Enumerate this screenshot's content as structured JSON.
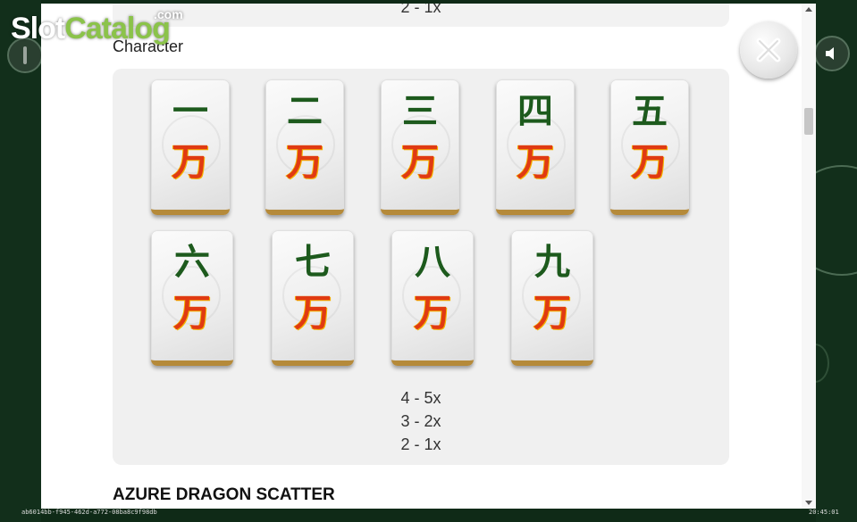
{
  "logo": {
    "part1": "Slot",
    "part2": "Catalog",
    "suffix": ".com"
  },
  "top_card": {
    "pay_line": "2 - 1x"
  },
  "character_section": {
    "title": "Character",
    "tiles": [
      {
        "numeral": "一",
        "suit": "万"
      },
      {
        "numeral": "二",
        "suit": "万"
      },
      {
        "numeral": "三",
        "suit": "万"
      },
      {
        "numeral": "四",
        "suit": "万"
      },
      {
        "numeral": "五",
        "suit": "万"
      },
      {
        "numeral": "六",
        "suit": "万"
      },
      {
        "numeral": "七",
        "suit": "万"
      },
      {
        "numeral": "八",
        "suit": "万"
      },
      {
        "numeral": "九",
        "suit": "万"
      }
    ],
    "pays": [
      "4 - 5x",
      "3 - 2x",
      "2 - 1x"
    ]
  },
  "next_section": {
    "title": "AZURE DRAGON SCATTER"
  },
  "footer": {
    "session_id": "ab6014bb-f945-462d-a772-08ba8c9f98db",
    "time": "20:45:01"
  },
  "icons": {
    "close": "close-icon",
    "sound": "speaker-icon"
  },
  "colors": {
    "numeral": "#1d5a1d",
    "suit": "#e03a12",
    "tile_base": "#b58a3a",
    "background": "#0f2a17"
  }
}
